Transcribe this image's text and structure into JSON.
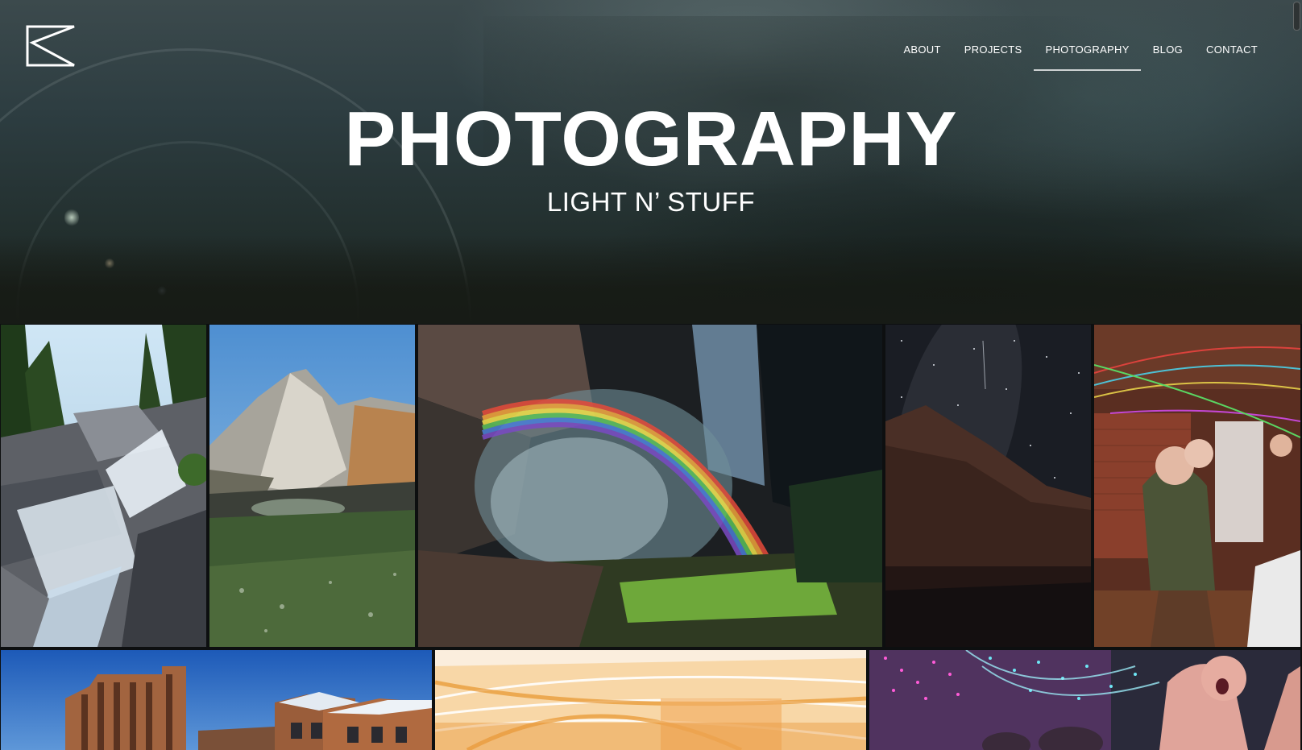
{
  "site": {
    "logo": "K"
  },
  "nav": {
    "items": [
      {
        "label": "ABOUT"
      },
      {
        "label": "PROJECTS"
      },
      {
        "label": "PHOTOGRAPHY"
      },
      {
        "label": "BLOG"
      },
      {
        "label": "CONTACT"
      }
    ],
    "active": "PHOTOGRAPHY"
  },
  "hero": {
    "title": "PHOTOGRAPHY",
    "subtitle": "LIGHT N’ STUFF"
  },
  "gallery": {
    "photos": [
      {
        "subject": "waterfall-cascade"
      },
      {
        "subject": "mountain-lake"
      },
      {
        "subject": "waterfall-rainbow"
      },
      {
        "subject": "milky-way-night"
      },
      {
        "subject": "party-light-trails"
      },
      {
        "subject": "brick-building"
      },
      {
        "subject": "golden-light-streaks"
      },
      {
        "subject": "laser-party"
      }
    ]
  }
}
